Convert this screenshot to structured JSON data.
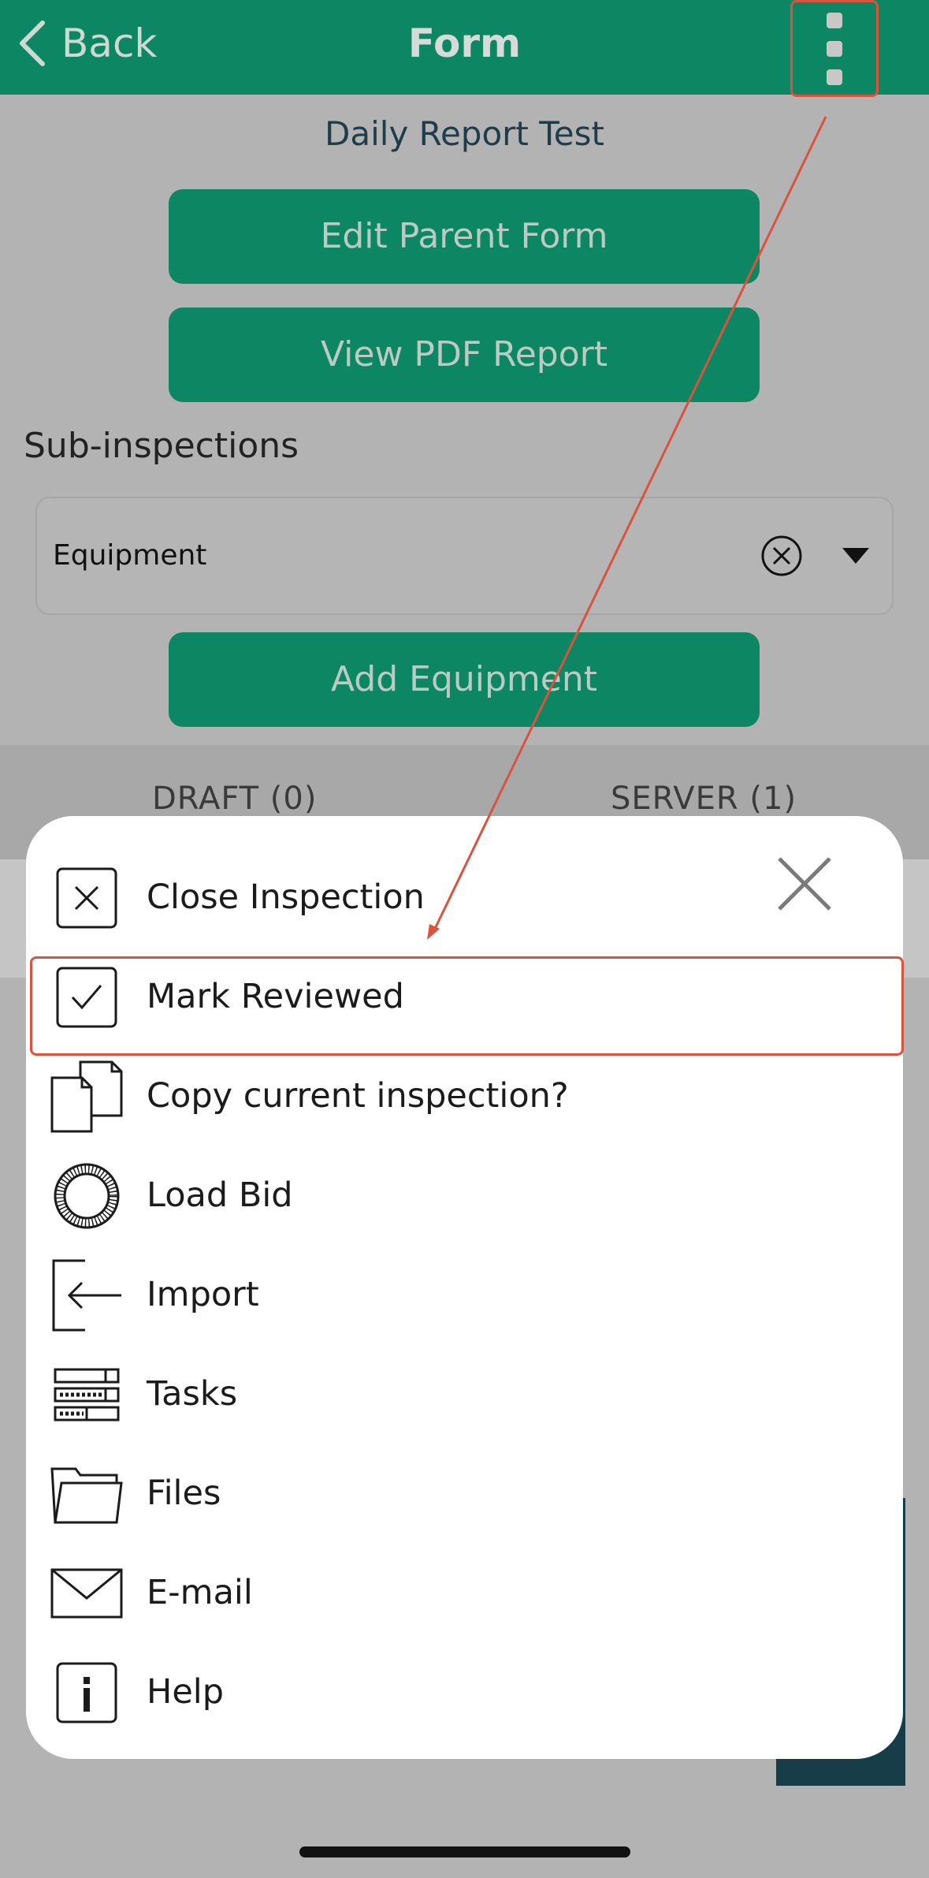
{
  "header": {
    "back_label": "Back",
    "title": "Form"
  },
  "form": {
    "report_title": "Daily Report Test",
    "edit_parent_label": "Edit Parent Form",
    "view_pdf_label": "View PDF Report",
    "sub_inspections_label": "Sub-inspections",
    "selected_value": "Equipment",
    "add_label": "Add Equipment"
  },
  "tabs": {
    "draft_label": "DRAFT (0)",
    "server_label": "SERVER (1)"
  },
  "menu": {
    "items": [
      {
        "label": "Close Inspection",
        "icon": "close-square-icon"
      },
      {
        "label": "Mark Reviewed",
        "icon": "check-square-icon"
      },
      {
        "label": "Copy current inspection?",
        "icon": "copy-icon"
      },
      {
        "label": "Load Bid",
        "icon": "bid-ring-icon"
      },
      {
        "label": "Import",
        "icon": "import-icon"
      },
      {
        "label": "Tasks",
        "icon": "tasks-icon"
      },
      {
        "label": "Files",
        "icon": "folder-icon"
      },
      {
        "label": "E-mail",
        "icon": "mail-icon"
      },
      {
        "label": "Help",
        "icon": "info-icon"
      }
    ]
  },
  "colors": {
    "brand_green": "#0d8663",
    "annotation_red": "#d9533f",
    "overlay_gray": "#b3b3b3"
  }
}
